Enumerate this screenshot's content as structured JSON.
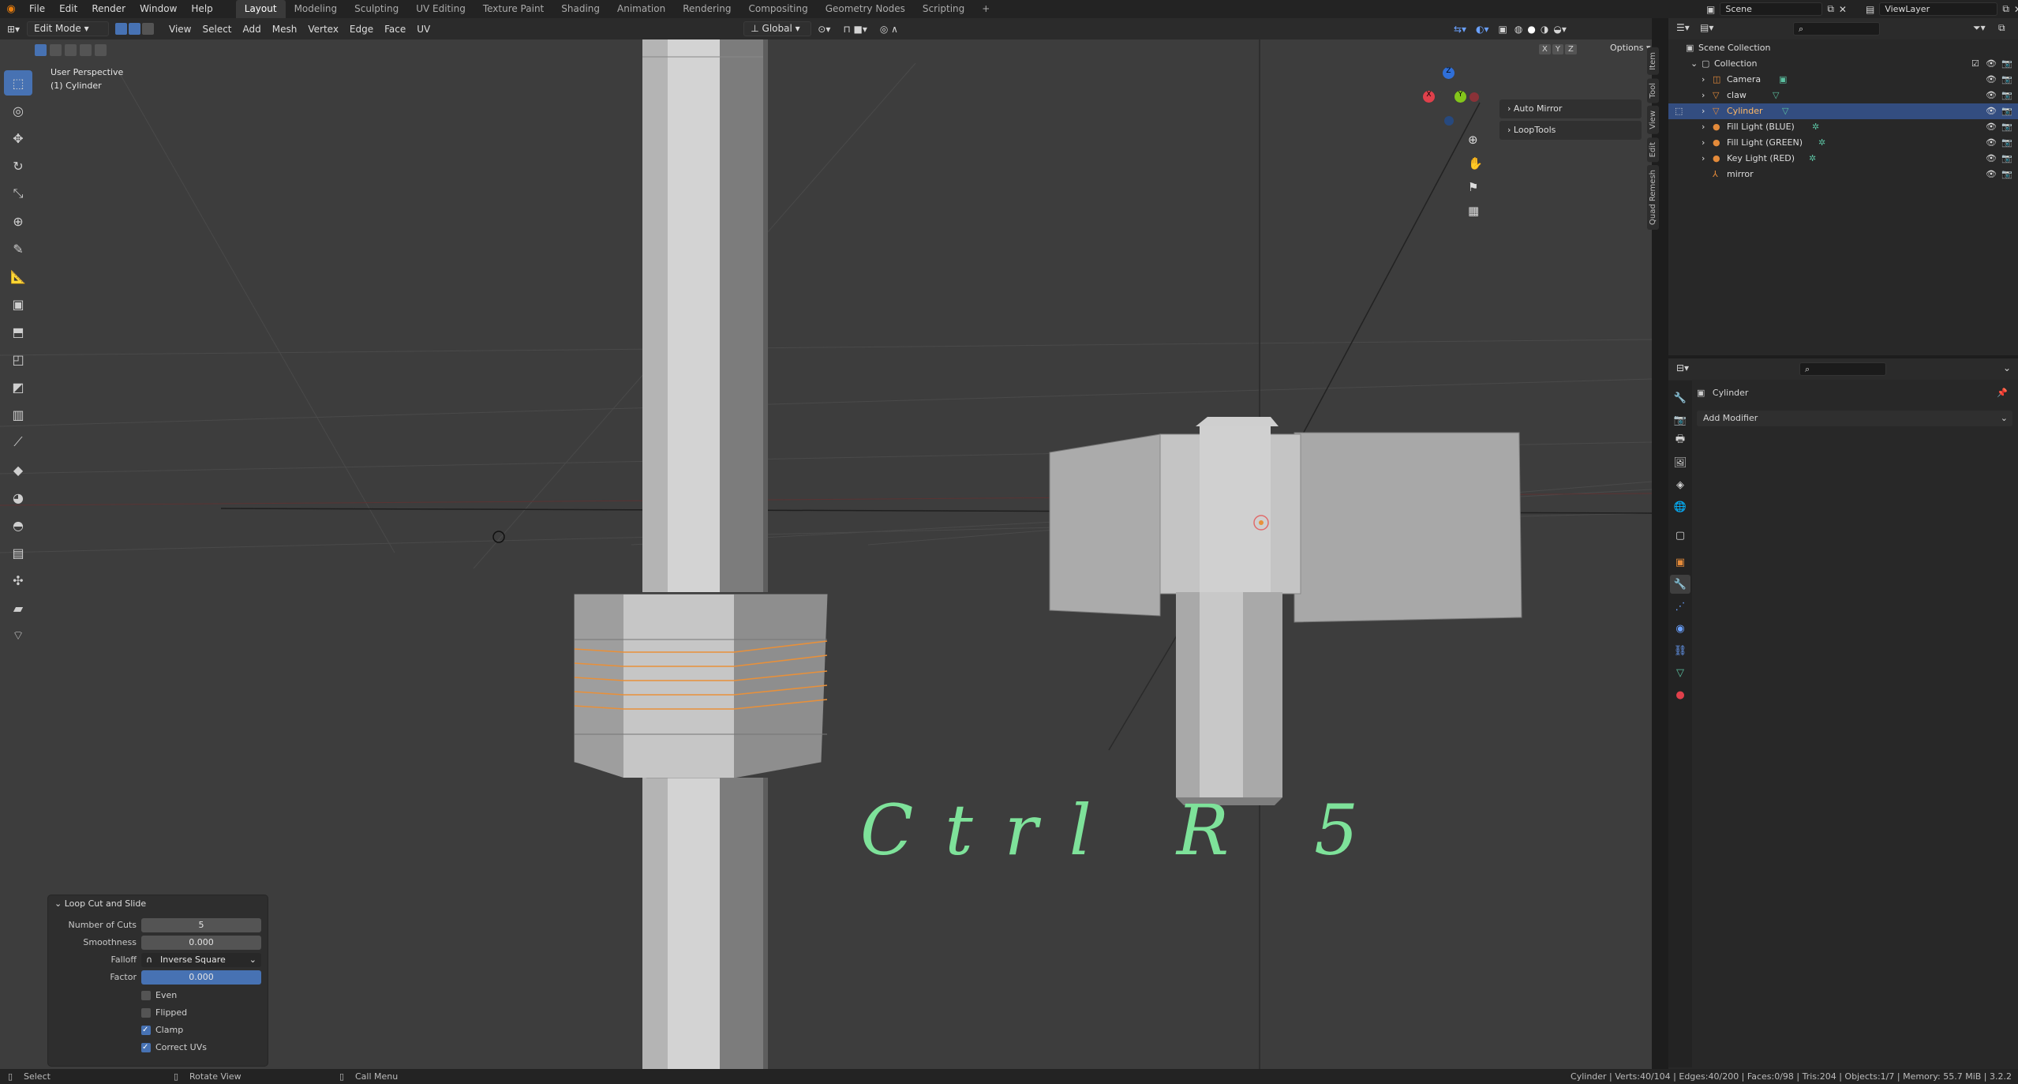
{
  "topbar": {
    "menus": [
      "File",
      "Edit",
      "Render",
      "Window",
      "Help"
    ],
    "workspaces": [
      "Layout",
      "Modeling",
      "Sculpting",
      "UV Editing",
      "Texture Paint",
      "Shading",
      "Animation",
      "Rendering",
      "Compositing",
      "Geometry Nodes",
      "Scripting"
    ],
    "active_workspace": "Layout",
    "add_tab": "+",
    "scene": "Scene",
    "view_layer": "ViewLayer"
  },
  "viewport_header": {
    "mode": "Edit Mode",
    "menus": [
      "View",
      "Select",
      "Add",
      "Mesh",
      "Vertex",
      "Edge",
      "Face",
      "UV"
    ],
    "orientation": "Global",
    "axes": [
      "X",
      "Y",
      "Z"
    ],
    "options": "Options"
  },
  "viewport": {
    "view_name": "User Perspective",
    "object_label": "(1) Cylinder",
    "annotation": "Ctrl R 5",
    "gizmo": {
      "x": "X",
      "y": "Y",
      "z": "Z"
    },
    "colors": {
      "selected_edge": "#e8903a",
      "annotation": "#7ee29a",
      "mesh": "#9a9a9a"
    }
  },
  "npanel": {
    "items": [
      "Auto Mirror",
      "LoopTools"
    ]
  },
  "sidetabs": [
    "Item",
    "Tool",
    "View",
    "Edit",
    "Quad Remesh"
  ],
  "operator_panel": {
    "title": "Loop Cut and Slide",
    "number_of_cuts_label": "Number of Cuts",
    "number_of_cuts": "5",
    "smoothness_label": "Smoothness",
    "smoothness": "0.000",
    "falloff_label": "Falloff",
    "falloff": "Inverse Square",
    "factor_label": "Factor",
    "factor": "0.000",
    "even": "Even",
    "flipped": "Flipped",
    "clamp": "Clamp",
    "correct_uvs": "Correct UVs",
    "checked": {
      "even": false,
      "flipped": false,
      "clamp": true,
      "correct_uvs": true
    }
  },
  "outliner": {
    "root": "Scene Collection",
    "collection": "Collection",
    "items": [
      "Camera",
      "claw",
      "Cylinder",
      "Fill Light (BLUE)",
      "Fill Light (GREEN)",
      "Key Light (RED)",
      "mirror"
    ],
    "selected": "Cylinder"
  },
  "properties": {
    "object_name": "Cylinder",
    "add_modifier": "Add Modifier"
  },
  "statusbar": {
    "select": "Select",
    "rotate": "Rotate View",
    "call_menu": "Call Menu",
    "stats": "Cylinder | Verts:40/104 | Edges:40/200 | Faces:0/98 | Tris:204 | Objects:1/7 | Memory: 55.7 MiB | 3.2.2"
  }
}
